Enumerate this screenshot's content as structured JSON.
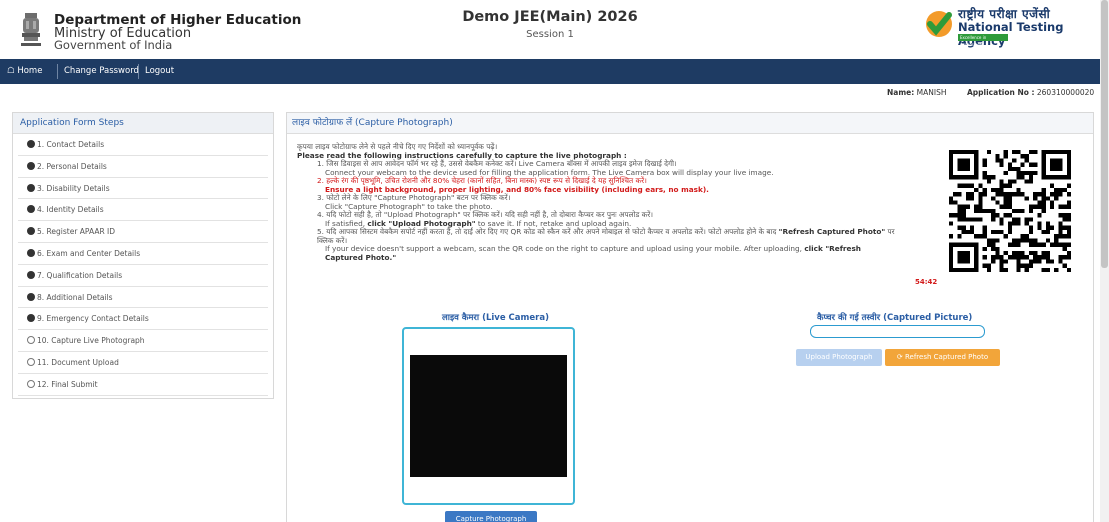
{
  "header": {
    "dept": "Department of Higher Education",
    "ministry": "Ministry of Education",
    "govt": "Government of India",
    "exam_title": "Demo JEE(Main) 2026",
    "session": "Session 1",
    "nta_hindi": "राष्ट्रीय परीक्षा एजेंसी",
    "nta_english": "National Testing Agency",
    "nta_tagline": "Excellence in Assessment"
  },
  "nav": {
    "home": "Home",
    "change_password": "Change Password",
    "logout": "Logout"
  },
  "user": {
    "name_label": "Name:",
    "name_value": "MANISH",
    "app_label": "Application No :",
    "app_value": "260310000020"
  },
  "sidebar": {
    "title": "Application Form Steps",
    "items": [
      {
        "label": "1. Contact Details",
        "done": true
      },
      {
        "label": "2. Personal Details",
        "done": true
      },
      {
        "label": "3. Disability Details",
        "done": true
      },
      {
        "label": "4. Identity Details",
        "done": true
      },
      {
        "label": "5. Register APAAR ID",
        "done": true
      },
      {
        "label": "6. Exam and Center Details",
        "done": true
      },
      {
        "label": "7. Qualification Details",
        "done": true
      },
      {
        "label": "8. Additional Details",
        "done": true
      },
      {
        "label": "9. Emergency Contact Details",
        "done": true
      },
      {
        "label": "10. Capture Live Photograph",
        "done": false
      },
      {
        "label": "11. Document Upload",
        "done": false
      },
      {
        "label": "12. Final Submit",
        "done": false
      }
    ]
  },
  "main": {
    "title": "लाइव फोटोग्राफ लें (Capture Photograph)",
    "instr_hindi_intro": "कृपया लाइव फोटोग्राफ लेने से पहले नीचे दिए गए निर्देशों को ध्यानपूर्वक पढ़ें।",
    "instr_intro": "Please read the following instructions carefully to capture the live photograph :",
    "i1_hindi": "1. जिस डिवाइस से आप आवेदन फॉर्म भर रहे हैं, उससे वेबकैम कनेक्ट करें। Live Camera बॉक्स में आपकी लाइव इमेज दिखाई देगी।",
    "i1_eng": "Connect your webcam to the device used for filling the application form. The Live Camera box will display your live image.",
    "i2_hindi": "2. हल्के रंग की पृष्ठभूमि, उचित रोशनी और 80% चेहरा (कानों सहित, बिना मास्क) स्पष्ट रूप से दिखाई दे यह सुनिश्चित करें।",
    "i2_eng": "Ensure a light background, proper lighting, and 80% face visibility (including ears, no mask).",
    "i3_hindi": "3. फोटो लेने के लिए \"Capture Photograph\" बटन पर क्लिक करें।",
    "i3_eng": "Click \"Capture Photograph\" to take the photo.",
    "i4_hindi": "4. यदि फोटो सही है, तो \"Upload Photograph\" पर क्लिक करें। यदि सही नहीं है, तो दोबारा कैप्चर कर पुनः अपलोड करें।",
    "i4_eng_pre": "If satisfied, ",
    "i4_eng_bold": "click \"Upload Photograph\"",
    "i4_eng_post": " to save it. If not, retake and upload again.",
    "i5_hindi": "5. यदि आपका सिस्टम वेबकैम सपोर्ट नहीं करता है, तो दाईं ओर दिए गए QR कोड को स्कैन करें और अपने मोबाइल से फोटो कैप्चर व अपलोड करें। फोटो अपलोड होने के बाद",
    "i5_hindi_bold": "\"Refresh Captured Photo\"",
    "i5_hindi_end": " पर क्लिक करें।",
    "i5_eng_pre": "If your device doesn't support a webcam, scan the QR code on the right to capture and upload using your mobile. After uploading, ",
    "i5_eng_bold": "click \"Refresh Captured Photo.\"",
    "timer": "54:42",
    "live_camera_title": "लाइव कैमरा (Live Camera)",
    "captured_title": "कैप्चर की गई तस्वीर (Captured Picture)",
    "capture_button": "Capture Photograph",
    "upload_button": "Upload Photograph",
    "refresh_button": "Refresh Captured Photo"
  },
  "colors": {
    "nav_bg": "#1e3b63",
    "heading_blue": "#2b5ea5",
    "warning_red": "#d21a1a",
    "refresh_orange": "#f2a53a",
    "upload_disabled": "#b7d0ef",
    "capture_blue": "#3b78c4"
  }
}
